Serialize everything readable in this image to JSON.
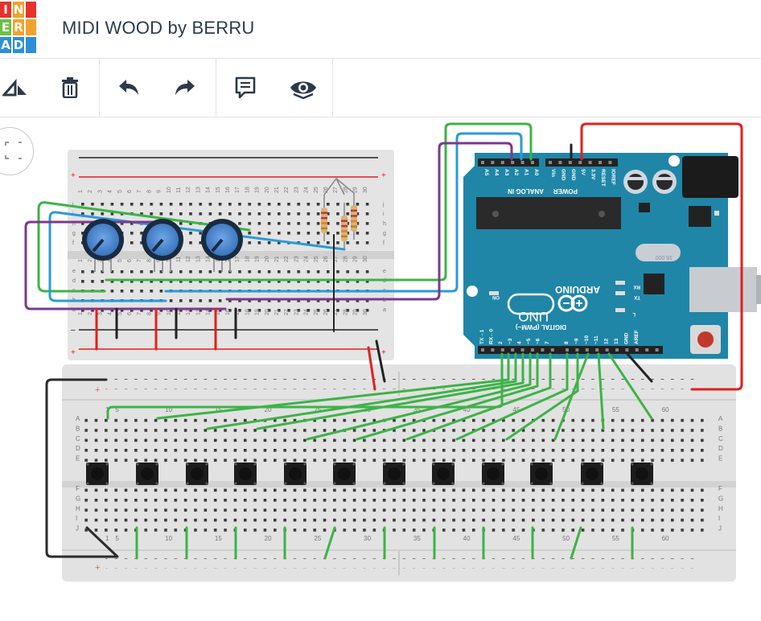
{
  "header": {
    "logo_letters": [
      "I",
      "N",
      "E",
      "R",
      "A",
      "D"
    ],
    "logo_colors": [
      "#e8312a",
      "#f2a22a",
      "#6bbf45",
      "#f2a22a",
      "#2d8fd6",
      "#2d8fd6"
    ],
    "title": "MIDI WOOD by BERRU"
  },
  "toolbar": {
    "tools": [
      {
        "name": "rotate-icon"
      },
      {
        "name": "delete-icon"
      },
      {
        "name": "undo-icon"
      },
      {
        "name": "redo-icon"
      },
      {
        "name": "notes-icon"
      },
      {
        "name": "visibility-icon"
      }
    ]
  },
  "canvas": {
    "arduino": {
      "brand": "ARDUINO",
      "model": "UNO",
      "analog_header": "ANALOG IN",
      "analog_pins": [
        "A5",
        "A4",
        "A3",
        "A2",
        "A1",
        "A0"
      ],
      "power_header": "POWER",
      "power_pins": [
        "Vin",
        "GND",
        "GND",
        "5V",
        "3.3V",
        "RESET",
        "IOREF"
      ],
      "digital_header": "DIGITAL (PWM~)",
      "digital_pins": [
        "TX→1",
        "RX←0",
        "2",
        "~3",
        "4",
        "~5",
        "~6",
        "7",
        "8",
        "~9",
        "~10",
        "~11",
        "12",
        "13",
        "GND",
        "AREF"
      ],
      "on_label": "ON",
      "led_labels": [
        "RX",
        "TX",
        "L"
      ],
      "crystal_label": "16.000"
    },
    "small_breadboard": {
      "row_letters_top": [
        "j",
        "i",
        "h",
        "g",
        "f"
      ],
      "row_letters_bottom": [
        "e",
        "d",
        "c",
        "b",
        "a"
      ],
      "column_numbers": [
        "1",
        "2",
        "3",
        "4",
        "5",
        "6",
        "7",
        "8",
        "9",
        "10",
        "11",
        "12",
        "13",
        "14",
        "15",
        "16",
        "17",
        "18",
        "19",
        "20",
        "21",
        "22",
        "23",
        "24",
        "25",
        "26",
        "27",
        "28",
        "29",
        "30"
      ]
    },
    "large_breadboard": {
      "row_letters_top": [
        "A",
        "B",
        "C",
        "D",
        "E"
      ],
      "row_letters_bottom": [
        "F",
        "G",
        "H",
        "I",
        "J"
      ],
      "column_numbers": [
        "1",
        "5",
        "10",
        "15",
        "20",
        "25",
        "30",
        "35",
        "40",
        "45",
        "50",
        "55",
        "60"
      ]
    },
    "colors": {
      "green": "#3db346",
      "blue": "#2a9ad8",
      "purple": "#7a3a8c",
      "red": "#e02020",
      "black": "#222222",
      "pot": "#3a7fc8"
    }
  }
}
